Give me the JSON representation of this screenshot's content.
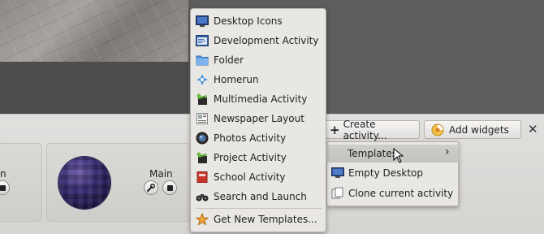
{
  "menu": {
    "items": [
      {
        "label": "Desktop Icons",
        "icon": "desktop-monitor-icon"
      },
      {
        "label": "Development Activity",
        "icon": "code-window-icon"
      },
      {
        "label": "Folder",
        "icon": "folder-icon"
      },
      {
        "label": "Homerun",
        "icon": "homerun-icon"
      },
      {
        "label": "Multimedia Activity",
        "icon": "film-clapper-icon"
      },
      {
        "label": "Newspaper Layout",
        "icon": "newspaper-icon"
      },
      {
        "label": "Photos Activity",
        "icon": "camera-lens-icon"
      },
      {
        "label": "Project Activity",
        "icon": "project-clapper-icon"
      },
      {
        "label": "School Activity",
        "icon": "school-book-icon"
      },
      {
        "label": "Search and Launch",
        "icon": "binoculars-icon"
      }
    ],
    "get_new": {
      "label": "Get New Templates...",
      "icon": "star-icon"
    }
  },
  "toolbar": {
    "create_activity": "Create activity...",
    "add_widgets": "Add widgets",
    "close_symbol": "✕"
  },
  "submenu": {
    "templates": "Templates",
    "empty_desktop": "Empty Desktop",
    "clone_current": "Clone current activity"
  },
  "activities": {
    "main_name": "Main",
    "left_name_fragment": "n"
  }
}
